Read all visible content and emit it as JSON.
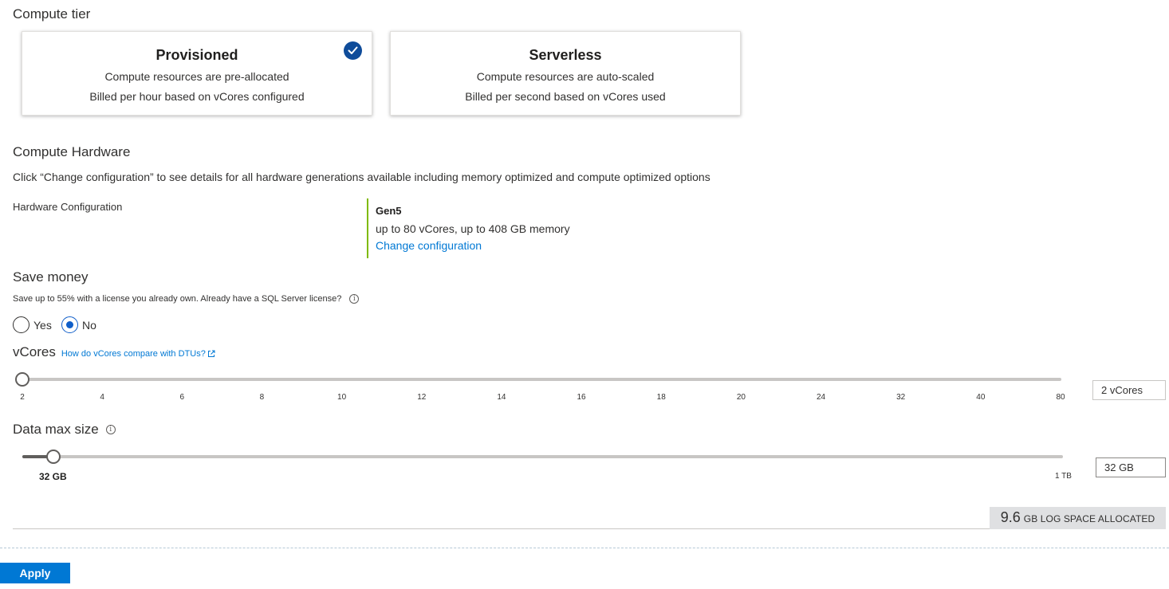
{
  "compute_tier": {
    "title": "Compute tier",
    "options": [
      {
        "name": "Provisioned",
        "line1": "Compute resources are pre-allocated",
        "line2": "Billed per hour based on vCores configured",
        "selected": true
      },
      {
        "name": "Serverless",
        "line1": "Compute resources are auto-scaled",
        "line2": "Billed per second based on vCores used",
        "selected": false
      }
    ]
  },
  "compute_hardware": {
    "title": "Compute Hardware",
    "description": "Click “Change configuration” to see details for all hardware generations available including memory optimized and compute optimized options",
    "label": "Hardware Configuration",
    "generation": "Gen5",
    "spec": "up to 80 vCores, up to 408 GB memory",
    "change_link": "Change configuration"
  },
  "save_money": {
    "title": "Save money",
    "question": "Save up to 55% with a license you already own. Already have a SQL Server license?",
    "options": [
      {
        "label": "Yes",
        "selected": false
      },
      {
        "label": "No",
        "selected": true
      }
    ]
  },
  "vcores": {
    "title": "vCores",
    "compare_link": "How do vCores compare with DTUs?",
    "ticks": [
      "2",
      "4",
      "6",
      "8",
      "10",
      "12",
      "14",
      "16",
      "18",
      "20",
      "24",
      "32",
      "40",
      "80"
    ],
    "selected_index": 0,
    "value_text": "2 vCores"
  },
  "data_max_size": {
    "title": "Data max size",
    "value_label": "32 GB",
    "max_label": "1 TB",
    "value_text": "32 GB",
    "fraction": 0.03
  },
  "log_space": {
    "value": "9.6",
    "unit": "GB LOG SPACE ALLOCATED"
  },
  "apply_label": "Apply",
  "colors": {
    "accent": "#0078d4",
    "check_badge": "#0f4c9a",
    "hardware_bar": "#7fba00"
  }
}
